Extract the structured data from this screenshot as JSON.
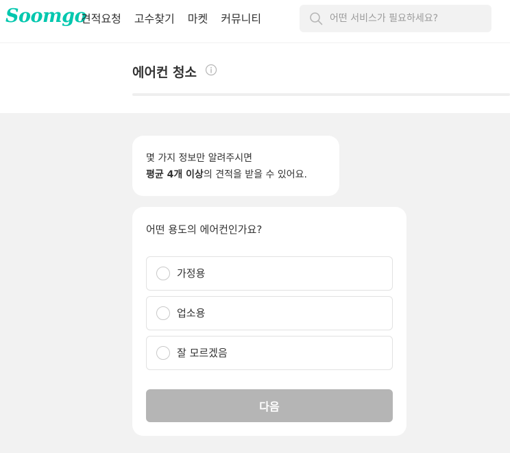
{
  "colors": {
    "brand": "#00c7ae",
    "page_background": "#f2f2f2",
    "disabled_button": "#b5b5b5",
    "text": "#323232",
    "placeholder": "#9b9b9b"
  },
  "header": {
    "logo_text": "Soomgo",
    "nav": [
      "견적요청",
      "고수찾기",
      "마켓",
      "커뮤니티"
    ],
    "search": {
      "placeholder": "어떤 서비스가 필요하세요?",
      "value": "",
      "icon": "search-icon"
    }
  },
  "title": {
    "text": "에어컨 청소",
    "info_icon": "info-icon",
    "progress": 0
  },
  "intro": {
    "line1": "몇 가지 정보만 알려주시면",
    "line2_bold": "평균 4개 이상",
    "line2_rest": "의 견적을 받을 수 있어요."
  },
  "question": {
    "text": "어떤 용도의 에어컨인가요?",
    "options": [
      "가정용",
      "업소용",
      "잘 모르겠음"
    ],
    "selected": null
  },
  "next_button": {
    "label": "다음",
    "enabled": false
  }
}
